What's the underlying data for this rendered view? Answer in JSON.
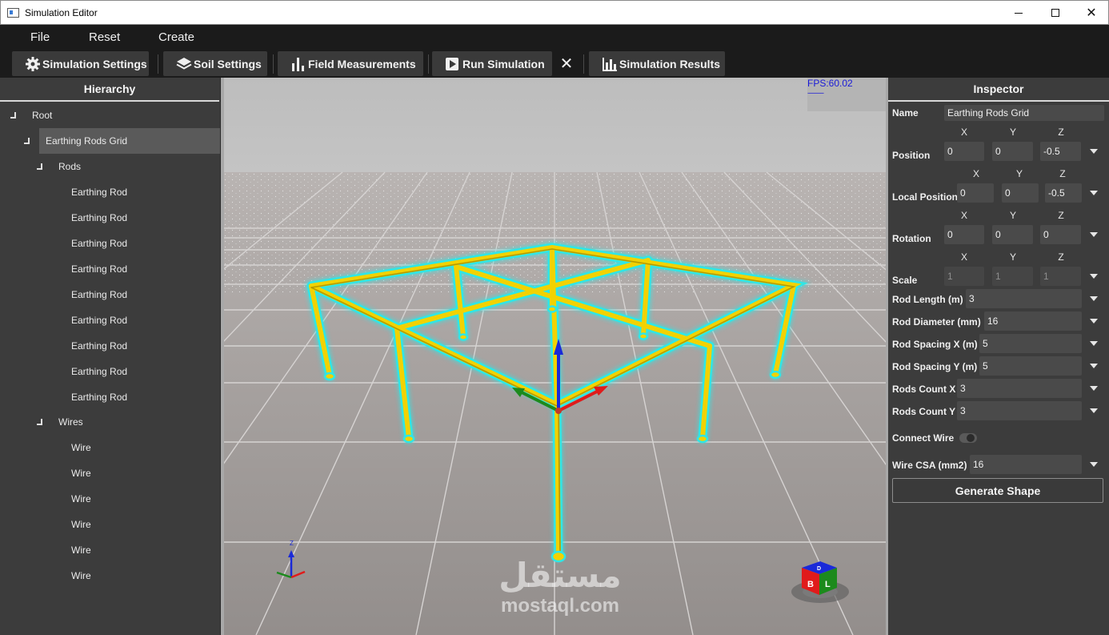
{
  "window": {
    "title": "Simulation Editor"
  },
  "menu": [
    "File",
    "Reset",
    "Create"
  ],
  "toolbar": {
    "simulation_settings": "Simulation Settings",
    "soil_settings": "Soil Settings",
    "field_measurements": "Field Measurements",
    "run_simulation": "Run Simulation",
    "close": "✕",
    "simulation_results": "Simulation Results"
  },
  "hierarchy": {
    "title": "Hierarchy",
    "root": "Root",
    "grid": "Earthing Rods Grid",
    "rods_group": "Rods",
    "rods": [
      "Earthing Rod",
      "Earthing Rod",
      "Earthing Rod",
      "Earthing Rod",
      "Earthing Rod",
      "Earthing Rod",
      "Earthing Rod",
      "Earthing Rod",
      "Earthing Rod"
    ],
    "wires_group": "Wires",
    "wires": [
      "Wire",
      "Wire",
      "Wire",
      "Wire",
      "Wire",
      "Wire"
    ]
  },
  "viewport": {
    "fps": "FPS:60.02",
    "fps_underline": "----------",
    "watermark_ar": "مستقل",
    "watermark_en": "mostaql.com",
    "axis_z": "Z",
    "cube_labels": [
      "B",
      "L",
      "D"
    ]
  },
  "inspector": {
    "title": "Inspector",
    "name_label": "Name",
    "name_value": "Earthing Rods Grid",
    "axis_labels": [
      "X",
      "Y",
      "Z"
    ],
    "position": {
      "label": "Position",
      "x": "0",
      "y": "0",
      "z": "-0.5"
    },
    "local_position": {
      "label": "Local Position",
      "x": "0",
      "y": "0",
      "z": "-0.5"
    },
    "rotation": {
      "label": "Rotation",
      "x": "0",
      "y": "0",
      "z": "0"
    },
    "scale": {
      "label": "Scale",
      "x": "1",
      "y": "1",
      "z": "1"
    },
    "rod_length": {
      "label": "Rod Length (m)",
      "value": "3"
    },
    "rod_diameter": {
      "label": "Rod Diameter (mm)",
      "value": "16"
    },
    "rod_spacing_x": {
      "label": "Rod Spacing X (m)",
      "value": "5"
    },
    "rod_spacing_y": {
      "label": "Rod Spacing Y (m)",
      "value": "5"
    },
    "rods_count_x": {
      "label": "Rods Count X",
      "value": "3"
    },
    "rods_count_y": {
      "label": "Rods Count Y",
      "value": "3"
    },
    "connect_wire": {
      "label": "Connect Wire",
      "enabled": false
    },
    "wire_csa": {
      "label": "Wire CSA (mm2)",
      "value": "16"
    },
    "generate_button": "Generate Shape"
  },
  "colors": {
    "rod": "#f2d200",
    "outline": "#2fe6e6",
    "gizmo_x": "#e01b1b",
    "gizmo_y": "#1c8a1c",
    "gizmo_z": "#1a2ad8"
  }
}
